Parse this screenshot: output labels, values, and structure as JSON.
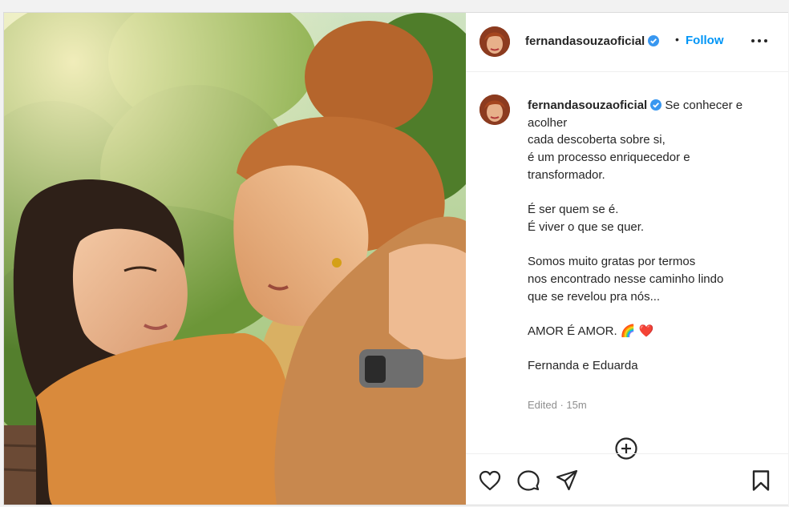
{
  "header": {
    "username": "fernandasouzaoficial",
    "verified": true,
    "separator": "•",
    "follow_label": "Follow",
    "more_icon": "more-horizontal-icon"
  },
  "caption": {
    "username": "fernandasouzaoficial",
    "lines": [
      "Se conhecer e",
      "acolher",
      "cada descoberta sobre si,",
      "é um processo enriquecedor e",
      "transformador.",
      "",
      "É ser quem se é.",
      "É viver o que se quer.",
      "",
      "Somos muito gratas por termos",
      "nos encontrado nesse caminho lindo",
      "que se revelou pra nós...",
      "",
      "AMOR É AMOR. 🌈 ❤️",
      "",
      "Fernanda e Eduarda"
    ],
    "edited": "Edited · 15m"
  },
  "icons": {
    "load_more": "plus-circle-icon",
    "like": "heart-icon",
    "comment": "comment-icon",
    "share": "send-icon",
    "save": "bookmark-icon"
  },
  "colors": {
    "link_blue": "#0095f6",
    "verified_blue": "#3897f0",
    "muted": "#8e8e8e"
  }
}
